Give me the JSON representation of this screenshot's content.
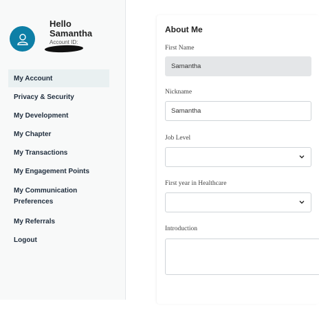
{
  "profile": {
    "greeting_line1": "Hello",
    "greeting_line2": "Samantha",
    "account_id_label": "Account ID:"
  },
  "nav": {
    "items": [
      {
        "label": "My Account",
        "active": true
      },
      {
        "label": "Privacy & Security"
      },
      {
        "label": "My Development"
      },
      {
        "label": "My Chapter"
      },
      {
        "label": "My Transactions"
      },
      {
        "label": "My Engagement Points"
      },
      {
        "label_line1": "My Communication",
        "label_line2": "Preferences"
      },
      {
        "label": "My Referrals"
      },
      {
        "label": "Logout"
      }
    ]
  },
  "about": {
    "title": "About Me",
    "first_name_label": "First Name",
    "first_name_value": "Samantha",
    "nickname_label": "Nickname",
    "nickname_value": "Samantha",
    "job_level_label": "Job Level",
    "job_level_value": "",
    "first_year_label": "First year in Healthcare",
    "first_year_value": "",
    "introduction_label": "Introduction"
  },
  "colors": {
    "avatar": "#0e7fa6",
    "active_nav_bg": "#e9f0f1",
    "disabled_field_bg": "#e4e6e8"
  }
}
